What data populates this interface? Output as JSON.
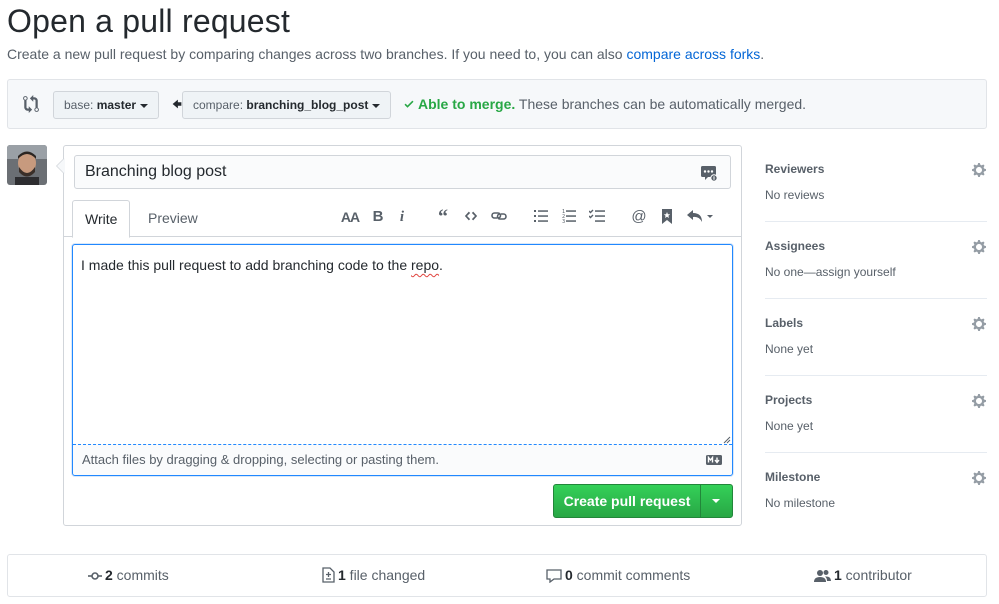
{
  "page": {
    "title": "Open a pull request",
    "subtitle": "Create a new pull request by comparing changes across two branches. If you need to, you can also",
    "subtitle_link": "compare across forks",
    "subtitle_end": "."
  },
  "range": {
    "base_prefix": "base:",
    "base_branch": "master",
    "compare_prefix": "compare:",
    "compare_branch": "branching_blog_post",
    "merge_ok": "Able to merge.",
    "merge_text": "These branches can be automatically merged."
  },
  "composer": {
    "title_value": "Branching blog post",
    "tabs": [
      "Write",
      "Preview"
    ],
    "body_value_start": "I made this pull request to add branching code to the ",
    "body_value_misspelled": "repo",
    "body_value_end": ".",
    "attach_hint": "Attach files by dragging & dropping, selecting or pasting them.",
    "submit_label": "Create pull request",
    "toolbar_icons": [
      "text-size-icon",
      "bold-icon",
      "italic-icon",
      "quote-icon",
      "code-icon",
      "link-icon",
      "unordered-list-icon",
      "ordered-list-icon",
      "task-list-icon",
      "mention-icon",
      "bookmark-icon",
      "reply-icon"
    ]
  },
  "sidebar": {
    "items": [
      {
        "title": "Reviewers",
        "value": "No reviews"
      },
      {
        "title": "Assignees",
        "value": "No one—assign yourself"
      },
      {
        "title": "Labels",
        "value": "None yet"
      },
      {
        "title": "Projects",
        "value": "None yet"
      },
      {
        "title": "Milestone",
        "value": "No milestone"
      }
    ]
  },
  "stats": {
    "commits_count": "2",
    "commits_label": " commits",
    "files_count": "1",
    "files_label": " file changed",
    "comments_count": "0",
    "comments_label": " commit comments",
    "contributors_count": "1",
    "contributors_label": " contributor"
  },
  "colors": {
    "link": "#0366d6",
    "success": "#28a745",
    "focus": "#2188ff",
    "muted": "#586069"
  }
}
